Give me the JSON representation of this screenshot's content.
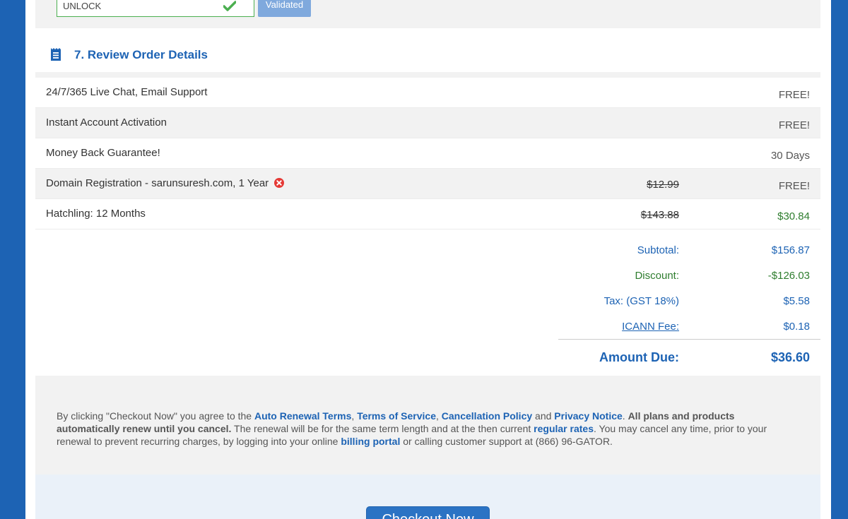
{
  "promo": {
    "code_value": "UNLOCK",
    "button_label": "Validated"
  },
  "section": {
    "title": "7. Review Order Details",
    "icon": "receipt-icon"
  },
  "items": [
    {
      "description": "24/7/365 Live Chat, Email Support",
      "original_price": "",
      "price": "FREE!",
      "price_color": "#555555"
    },
    {
      "description": "Instant Account Activation",
      "original_price": "",
      "price": "FREE!",
      "price_color": "#555555"
    },
    {
      "description": "Money Back Guarantee!",
      "original_price": "",
      "price": "30 Days",
      "price_color": "#555555"
    },
    {
      "description": "Domain Registration - sarunsuresh.com, 1 Year",
      "original_price": "$12.99",
      "price": "FREE!",
      "price_color": "#555555",
      "removable": true
    },
    {
      "description": "Hatchling: 12 Months",
      "original_price": "$143.88",
      "price": "$30.84",
      "price_color": "#2e7d2e"
    }
  ],
  "totals": {
    "subtotal_label": "Subtotal:",
    "subtotal_value": "$156.87",
    "discount_label": "Discount:",
    "discount_value": "-$126.03",
    "tax_label": "Tax: (GST 18%)",
    "tax_value": "$5.58",
    "icann_label": "ICANN Fee:",
    "icann_value": "$0.18",
    "amount_due_label": "Amount Due:",
    "amount_due_value": "$36.60"
  },
  "terms": {
    "t1": "By clicking \"Checkout Now\" you agree to the ",
    "link_auto_renewal": "Auto Renewal Terms",
    "sep1": ", ",
    "link_tos": "Terms of Service",
    "sep2": ", ",
    "link_cancellation": "Cancellation Policy",
    "t2": " and ",
    "link_privacy": "Privacy Notice",
    "t3": ". ",
    "bold_text": "All plans and products automatically renew until you cancel.",
    "t4": " The renewal will be for the same term length and at the then current ",
    "link_rates": "regular rates",
    "t5": ". You may cancel any time, prior to your renewal to prevent recurring charges, by logging into your online ",
    "link_billing": "billing portal",
    "t6": " or calling customer support at (866) 96-GATOR."
  },
  "checkout": {
    "button_label": "Checkout Now"
  },
  "colors": {
    "brand_blue": "#1d63b4",
    "success_green": "#2e7d2e",
    "remove_red": "#e53935"
  }
}
